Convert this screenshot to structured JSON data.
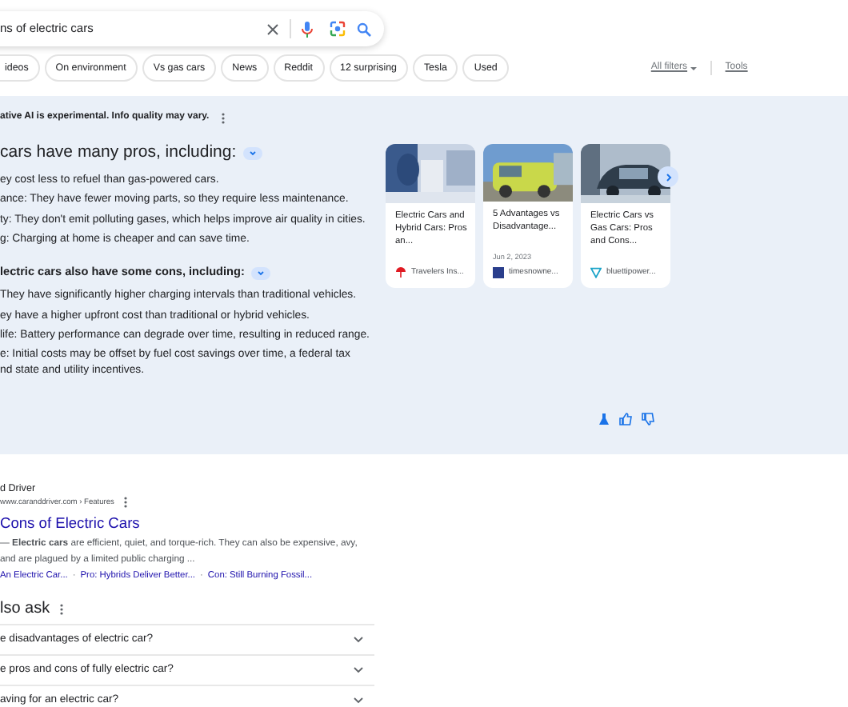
{
  "search": {
    "query": "ns of electric cars"
  },
  "chips": [
    {
      "label": "ideos"
    },
    {
      "label": "On environment"
    },
    {
      "label": "Vs gas cars"
    },
    {
      "label": "News"
    },
    {
      "label": "Reddit"
    },
    {
      "label": "12 surprising"
    },
    {
      "label": "Tesla"
    },
    {
      "label": "Used"
    }
  ],
  "filters": {
    "all_filters": "All filters",
    "tools": "Tools"
  },
  "ai_overview": {
    "notice": "ative AI is experimental. Info quality may vary.",
    "pros_heading": "cars have many pros, including:",
    "pros": [
      "ey cost less to refuel than gas-powered cars.",
      "ance: They have fewer moving parts, so they require less maintenance.",
      "ty: They don't emit polluting gases, which helps improve air quality in cities.",
      "g: Charging at home is cheaper and can save time."
    ],
    "cons_heading": "lectric cars also have some cons, including:",
    "cons": [
      "They have significantly higher charging intervals than traditional vehicles.",
      "ey have a higher upfront cost than traditional or hybrid vehicles.",
      "life: Battery performance can degrade over time, resulting in reduced range.",
      "e: Initial costs may be offset by fuel cost savings over time, a federal tax nd state and utility incentives."
    ],
    "sources": [
      {
        "title": "Electric Cars and Hybrid Cars: Pros an...",
        "site": "Travelers Ins..."
      },
      {
        "title": "5 Advantages vs Disadvantage...",
        "date": "Jun 2, 2023",
        "site": "timesnowne..."
      },
      {
        "title": "Electric Cars vs Gas Cars: Pros and Cons...",
        "site": "bluettipower..."
      }
    ]
  },
  "result": {
    "site": "d Driver",
    "url": "www.caranddriver.com › Features",
    "title": "Cons of Electric Cars",
    "snippet": "— **Electric cars** are efficient, quiet, and torque-rich. They can also be expensive, avy, and are plagued by a limited public charging ...",
    "links": [
      "An Electric Car...",
      "Pro: Hybrids Deliver Better...",
      "Con: Still Burning Fossil..."
    ],
    "separator": "·"
  },
  "people_also_ask": {
    "heading": "lso ask",
    "questions": [
      "e disadvantages of electric car?",
      "e pros and cons of fully electric car?",
      "aving for an electric car?"
    ]
  }
}
